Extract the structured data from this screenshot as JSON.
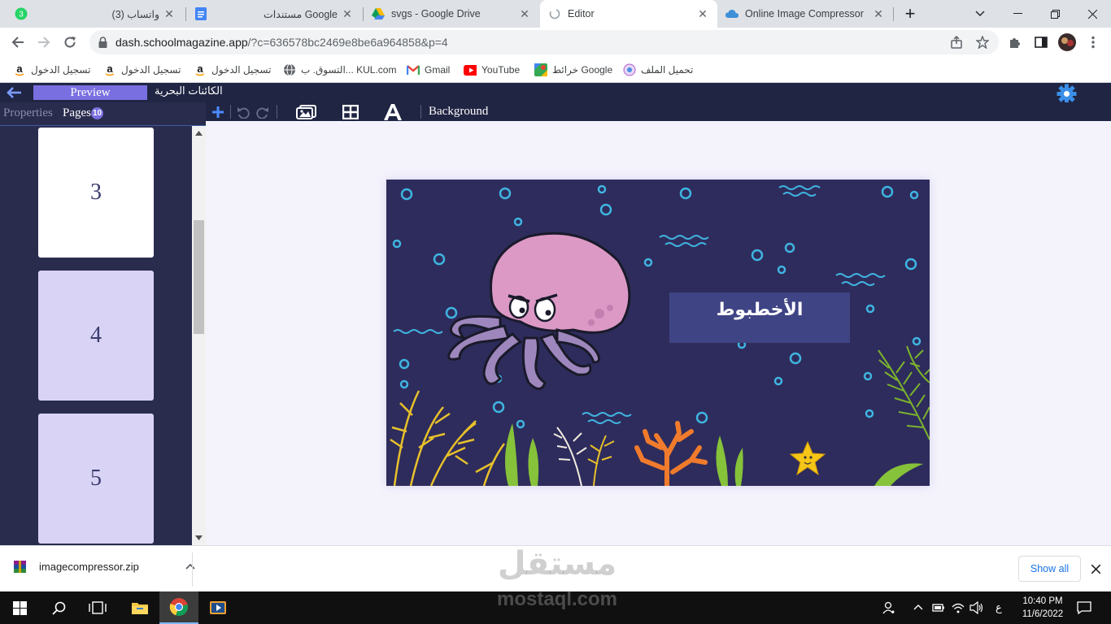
{
  "browser": {
    "tabs": [
      {
        "title": "(3) واتساب",
        "badge": "3",
        "icon": "whatsapp-icon",
        "active": false
      },
      {
        "title": "مستندات Google",
        "icon": "google-docs-icon",
        "active": false
      },
      {
        "title": "svgs - Google Drive",
        "icon": "google-drive-icon",
        "active": false
      },
      {
        "title": "Editor",
        "icon": "loading-icon",
        "active": true
      },
      {
        "title": "Online Image Compressor",
        "icon": "cloud-icon",
        "active": false
      }
    ],
    "url_host": "dash.schoolmagazine.app",
    "url_path": "/?c=636578bc2469e8be6a964858&p=4",
    "bookmarks": [
      {
        "label": "تحميل الملف",
        "icon": "upload-icon"
      },
      {
        "label": "خرائط Google",
        "icon": "google-maps-icon"
      },
      {
        "label": "YouTube",
        "icon": "youtube-icon"
      },
      {
        "label": "Gmail",
        "icon": "gmail-icon"
      },
      {
        "label": "التسوق. ب... KUL.com",
        "icon": "globe-icon"
      },
      {
        "label": "تسجيل الدخول",
        "icon": "amazon-icon"
      },
      {
        "label": "تسجيل الدخول",
        "icon": "amazon-icon"
      },
      {
        "label": "تسجيل الدخول",
        "icon": "amazon-icon"
      }
    ]
  },
  "app": {
    "preview_label": "Preview",
    "project_title": "الكائنات البحرية",
    "sidebar_tabs": {
      "properties": "Properties",
      "pages": "Pages",
      "pages_count": "10"
    },
    "page_thumbs": [
      {
        "number": "3",
        "bg": "#ffffff"
      },
      {
        "number": "4",
        "bg": "#d9d4f6"
      },
      {
        "number": "5",
        "bg": "#d9d4f6"
      }
    ],
    "toolbar": {
      "background_label": "Background"
    },
    "slide": {
      "title": "الأخطبوط",
      "bg": "#2e2c5c"
    }
  },
  "downloads": {
    "file_name": "imagecompressor.zip",
    "show_all": "Show all"
  },
  "watermark": {
    "arabic": "مستقل",
    "latin": "mostaql.com"
  },
  "taskbar": {
    "time": "10:40 PM",
    "date": "11/6/2022",
    "lang": "ع"
  },
  "colors": {
    "accent": "#7a6fe0",
    "app_bar": "#202543",
    "sidebar": "#2a2c4e"
  }
}
